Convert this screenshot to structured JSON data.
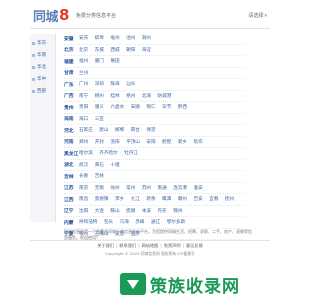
{
  "header": {
    "logo_main": "同城",
    "logo_num": "8",
    "slogan": "免费分类信息平台",
    "right_text": "请选择",
    "right_icon": "chevron-down-icon"
  },
  "sidebar": {
    "items": [
      {
        "label": "华东"
      },
      {
        "label": "华南"
      },
      {
        "label": "华北"
      },
      {
        "label": "华中"
      },
      {
        "label": "西部"
      }
    ]
  },
  "rows": [
    {
      "prov": "安徽",
      "cities": [
        "安庆",
        "蚌埠",
        "亳州",
        "池州",
        "滁州"
      ]
    },
    {
      "prov": "北京",
      "cities": [
        "北京",
        "东城",
        "西城",
        "朝阳",
        "海淀"
      ]
    },
    {
      "prov": "福建",
      "cities": [
        "福州",
        "厦门",
        "莆田"
      ]
    },
    {
      "prov": "甘肃",
      "cities": [
        "兰州"
      ]
    },
    {
      "prov": "广东",
      "cities": [
        "广州",
        "深圳",
        "珠海",
        "汕头"
      ]
    },
    {
      "prov": "广西",
      "cities": [
        "南宁",
        "柳州",
        "桂林",
        "梧州",
        "北海",
        "防城港"
      ]
    },
    {
      "prov": "贵州",
      "cities": [
        "贵阳",
        "遵义",
        "六盘水",
        "安顺",
        "铜仁",
        "毕节",
        "黔西"
      ]
    },
    {
      "prov": "海南",
      "cities": [
        "海口",
        "三亚"
      ]
    },
    {
      "prov": "河北",
      "cities": [
        "石家庄",
        "唐山",
        "邯郸",
        "邢台",
        "保定"
      ]
    },
    {
      "prov": "河南",
      "cities": [
        "郑州",
        "开封",
        "洛阳",
        "平顶山",
        "安阳",
        "鹤壁",
        "新乡",
        "焦作"
      ]
    },
    {
      "prov": "黑龙江",
      "cities": [
        "哈尔滨",
        "齐齐哈尔",
        "牡丹江"
      ]
    },
    {
      "prov": "湖北",
      "cities": [
        "武汉",
        "黄石",
        "十堰"
      ]
    },
    {
      "prov": "吉林",
      "cities": [
        "长春",
        "吉林"
      ]
    },
    {
      "prov": "江苏",
      "cities": [
        "南京",
        "无锡",
        "徐州",
        "常州",
        "苏州",
        "南通",
        "连云港",
        "淮安"
      ]
    },
    {
      "prov": "江西",
      "cities": [
        "南昌",
        "景德镇",
        "萍乡",
        "九江",
        "新余",
        "鹰潭",
        "赣州",
        "吉安",
        "宜春",
        "抚州"
      ]
    },
    {
      "prov": "辽宁",
      "cities": [
        "沈阳",
        "大连",
        "鞍山",
        "抚顺",
        "本溪",
        "丹东",
        "锦州"
      ]
    },
    {
      "prov": "内蒙",
      "cities": [
        "呼和浩特",
        "包头",
        "乌海",
        "赤峰",
        "通辽",
        "鄂尔多斯"
      ]
    },
    {
      "prov": "宁夏",
      "cities": [
        "银川",
        "石嘴山",
        "吴忠",
        "固原"
      ]
    }
  ],
  "info_text": "同城信息网是一个免费的同城分类信息发布平台，为您提供同城生活、招聘、求职、二手、房产、宠物等信息服务，欢迎使用！",
  "footer": {
    "links": [
      "关于我们",
      "联系我们",
      "网站地图",
      "免责声明",
      "意见反馈"
    ],
    "copyright": "Copyright © 2023 同城信息网 版权所有 ICP备案号"
  },
  "watermark": {
    "text": "策族收录网",
    "icon": "download-arrow-icon",
    "color": "#1a9b55"
  },
  "colors": {
    "link": "#3a66a8",
    "province": "#1f4e96",
    "logo": "#5a7fb8",
    "logo_accent": "#e8382a"
  }
}
